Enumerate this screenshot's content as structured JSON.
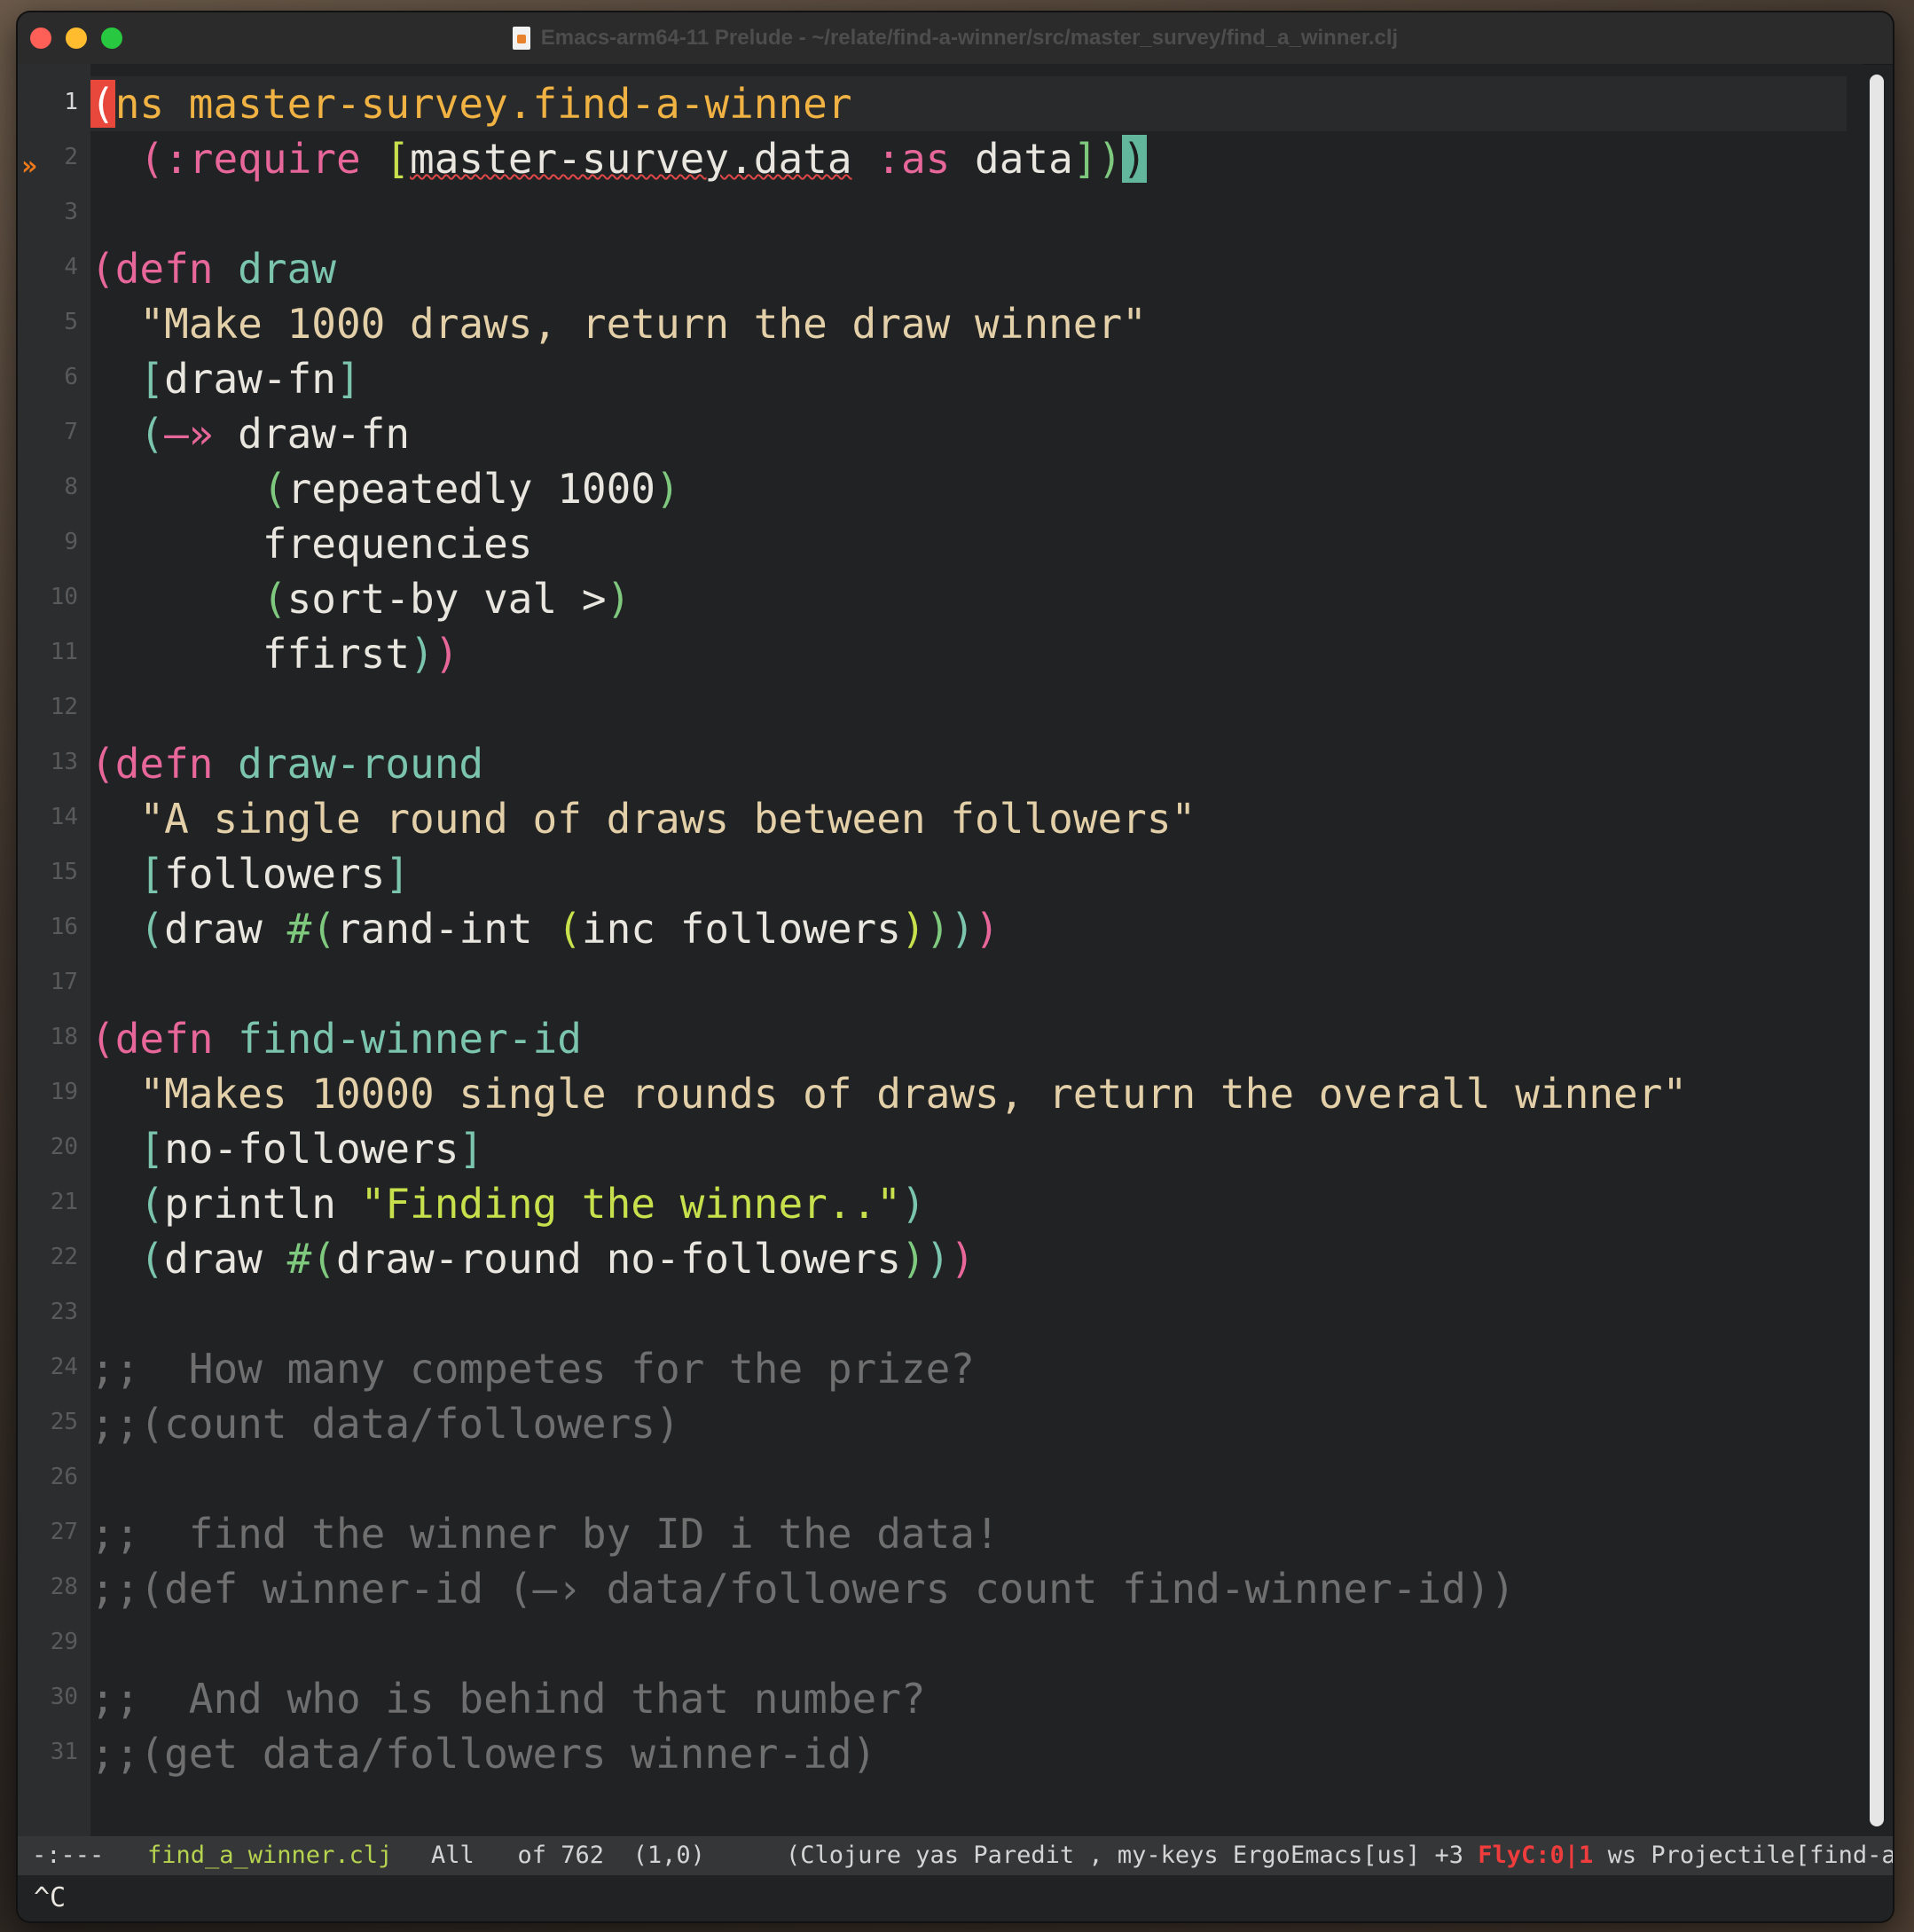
{
  "window": {
    "title": "Emacs-arm64-11 Prelude - ~/relate/find-a-winner/src/master_survey/find_a_winner.clj"
  },
  "icons": {
    "close": "close-icon",
    "minimize": "minimize-icon",
    "maximize": "maximize-icon",
    "document": "document-icon",
    "fringe_arrow": "fringe-arrow-icon"
  },
  "colors": {
    "background": "#212224",
    "keyword_pink": "#e7679a",
    "namespace_orange": "#f0b343",
    "function_teal": "#7bc5ad",
    "string_tan": "#e4d0a8",
    "comment_gray": "#6f6f6f",
    "paren_green": "#7fc97f",
    "cursor_red": "#e8473c",
    "modeline_filename": "#b6d44f",
    "flycheck_red": "#ef3c3c"
  },
  "gutter": {
    "line_numbers": [
      "1",
      "2",
      "3",
      "4",
      "5",
      "6",
      "7",
      "8",
      "9",
      "10",
      "11",
      "12",
      "13",
      "14",
      "15",
      "16",
      "17",
      "18",
      "19",
      "20",
      "21",
      "22",
      "23",
      "24",
      "25",
      "26",
      "27",
      "28",
      "29",
      "30",
      "31"
    ],
    "fringe_marker": "»"
  },
  "code": {
    "l1": {
      "c1": "(",
      "c2": "ns",
      "c3": " master-survey.find-a-winner"
    },
    "l2": {
      "c1": "  (",
      "c2": ":require",
      "c3": " [",
      "c4": "master-survey.data",
      "c5": " ",
      "c6": ":as",
      "c7": " data",
      "c8": "])",
      "c9": ")"
    },
    "l4": {
      "c1": "(",
      "c2": "defn",
      "c3": " draw"
    },
    "l5": "  \"Make 1000 draws, return the draw winner\"",
    "l6": {
      "c1": "  [",
      "c2": "draw-fn",
      "c3": "]"
    },
    "l7": {
      "c1": "  (",
      "c2": "—»",
      "c3": " draw-fn"
    },
    "l8": {
      "c1": "       (",
      "c2": "repeatedly 1000",
      "c3": ")"
    },
    "l9": "       frequencies",
    "l10": {
      "c1": "       (",
      "c2": "sort-by val >",
      "c3": ")"
    },
    "l11": {
      "c1": "       ffirst",
      "c2": ")",
      "c3": ")"
    },
    "l13": {
      "c1": "(",
      "c2": "defn",
      "c3": " draw-round"
    },
    "l14": "  \"A single round of draws between followers\"",
    "l15": {
      "c1": "  [",
      "c2": "followers",
      "c3": "]"
    },
    "l16": {
      "c1": "  (",
      "c2": "draw ",
      "c3": "#(",
      "c4": "rand-int ",
      "c5": "(",
      "c6": "inc followers",
      "c7": ")",
      "c8": ")",
      "c9": ")",
      "c10": ")"
    },
    "l18": {
      "c1": "(",
      "c2": "defn",
      "c3": " find-winner-id"
    },
    "l19": "  \"Makes 10000 single rounds of draws, return the overall winner\"",
    "l20": {
      "c1": "  [",
      "c2": "no-followers",
      "c3": "]"
    },
    "l21": {
      "c1": "  (",
      "c2": "println ",
      "c3": "\"Finding the winner..\"",
      "c4": ")"
    },
    "l22": {
      "c1": "  (",
      "c2": "draw ",
      "c3": "#(",
      "c4": "draw-round no-followers",
      "c5": ")",
      "c6": ")",
      "c7": ")"
    },
    "l24": ";;  How many competes for the prize?",
    "l25": ";;(count data/followers)",
    "l27": ";;  find the winner by ID i the data!",
    "l28": ";;(def winner-id (—› data/followers count find-winner-id))",
    "l30": ";;  And who is behind that number?",
    "l31": ";;(get data/followers winner-id)"
  },
  "modeline": {
    "status": "-:---",
    "filename": "find_a_winner.clj",
    "position": "All   of 762  (1,0)",
    "modes_prefix": "(Clojure yas Paredit , my-keys ErgoEmacs[us] +3 ",
    "flycheck": "FlyC:0|1",
    "modes_suffix": " ws Projectile[find-a-"
  },
  "echo_area": {
    "text": "^C"
  }
}
